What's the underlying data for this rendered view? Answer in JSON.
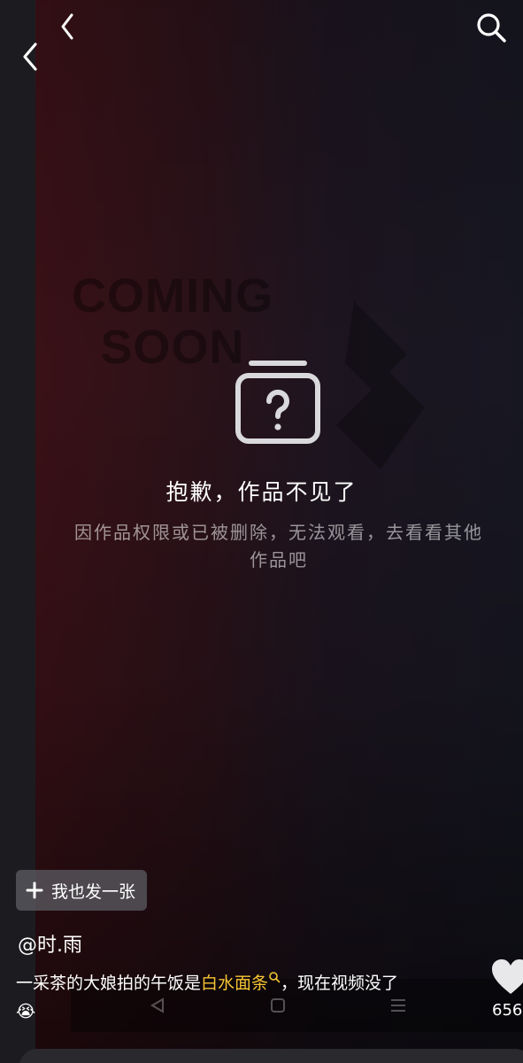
{
  "watermark": {
    "line1": "COMING",
    "line2": "SOON"
  },
  "empty_state": {
    "title": "抱歉，作品不见了",
    "subtitle": "因作品权限或已被删除，无法观看，去看看其他作品吧",
    "icon": "question-card-icon"
  },
  "post_button": {
    "label": "我也发一张",
    "icon": "plus-icon"
  },
  "author": {
    "handle": "@时.雨"
  },
  "caption": {
    "prefix": "一采茶的大娘拍的午饭是",
    "tag": "白水面条",
    "suffix": "，现在视频没了",
    "emoji": "😭"
  },
  "like": {
    "count": "656",
    "icon": "heart-icon"
  },
  "colors": {
    "accent_tag": "#f6c434",
    "video_red": "#3a1117"
  },
  "icons": [
    "back-icon",
    "back-icon",
    "search-icon",
    "question-card-icon",
    "plus-icon",
    "heart-icon",
    "nav-back-icon",
    "nav-home-icon",
    "nav-menu-icon",
    "search-tag-icon"
  ]
}
